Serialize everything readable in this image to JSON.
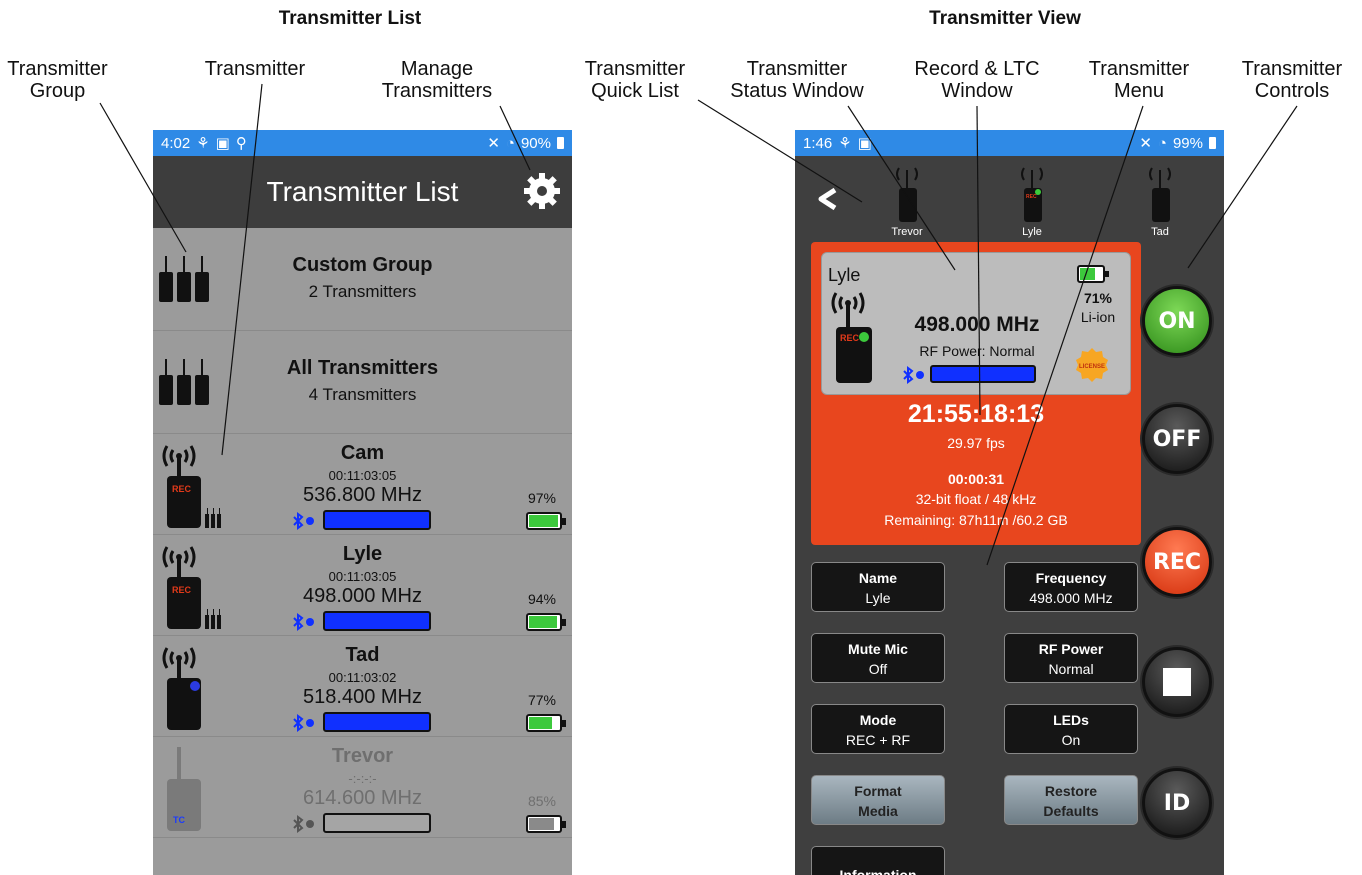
{
  "headings": {
    "left": "Transmitter List",
    "right": "Transmitter View"
  },
  "callouts": {
    "group": "Transmitter\nGroup",
    "transmitter": "Transmitter",
    "manage": "Manage\nTransmitters",
    "quick_list": "Transmitter\nQuick List",
    "status_window": "Transmitter\nStatus Window",
    "record_ltc": "Record & LTC\nWindow",
    "menu": "Transmitter\nMenu",
    "controls": "Transmitter\nControls"
  },
  "left_phone": {
    "statusbar": {
      "time": "4:02",
      "battery": "90%"
    },
    "title": "Transmitter List",
    "groups": [
      {
        "title": "Custom Group",
        "subtitle": "2 Transmitters"
      },
      {
        "title": "All Transmitters",
        "subtitle": "4 Transmitters"
      }
    ],
    "transmitters": [
      {
        "name": "Cam",
        "timecode": "00:11:03:05",
        "frequency": "536.800 MHz",
        "battery": "97%",
        "battery_level": 0.97,
        "led": "REC"
      },
      {
        "name": "Lyle",
        "timecode": "00:11:03:05",
        "frequency": "498.000 MHz",
        "battery": "94%",
        "battery_level": 0.94,
        "led": "REC"
      },
      {
        "name": "Tad",
        "timecode": "00:11:03:02",
        "frequency": "518.400 MHz",
        "battery": "77%",
        "battery_level": 0.77,
        "led": ""
      },
      {
        "name": "Trevor",
        "timecode": "-:-:-:-",
        "frequency": "614.600 MHz",
        "battery": "85%",
        "battery_level": 0.85,
        "led": "TC"
      }
    ]
  },
  "right_phone": {
    "statusbar": {
      "time": "1:46",
      "battery": "99%"
    },
    "quick_list": [
      "Trevor",
      "Lyle",
      "Tad"
    ],
    "status": {
      "name": "Lyle",
      "frequency": "498.000 MHz",
      "rf_power": "RF Power: Normal",
      "battery_pct": "71%",
      "battery_level": 0.71,
      "chemistry": "Li-ion",
      "license": "LICENSE",
      "led": "REC"
    },
    "ltc": {
      "timecode": "21:55:18:13",
      "fps": "29.97 fps",
      "elapsed": "00:00:31",
      "format": "32-bit float / 48 kHz",
      "remaining": "Remaining: 87h11m /60.2 GB"
    },
    "menu": [
      {
        "title": "Name",
        "value": "Lyle"
      },
      {
        "title": "Frequency",
        "value": "498.000 MHz"
      },
      {
        "title": "Mute Mic",
        "value": "Off"
      },
      {
        "title": "RF Power",
        "value": "Normal"
      },
      {
        "title": "Mode",
        "value": "REC + RF"
      },
      {
        "title": "LEDs",
        "value": "On"
      },
      {
        "title": "Format",
        "value": "Media"
      },
      {
        "title": "Restore",
        "value": "Defaults"
      },
      {
        "title": "Information",
        "value": ""
      }
    ],
    "controls": {
      "on": "ON",
      "off": "OFF",
      "rec": "REC",
      "id": "ID"
    }
  },
  "colors": {
    "status_bar": "#2f8ae6",
    "header": "#3d3d3d",
    "list_bg": "#9b9b9b",
    "record_window": "#e8461e",
    "meter": "#1030ff",
    "battery": "#3cc93c"
  }
}
